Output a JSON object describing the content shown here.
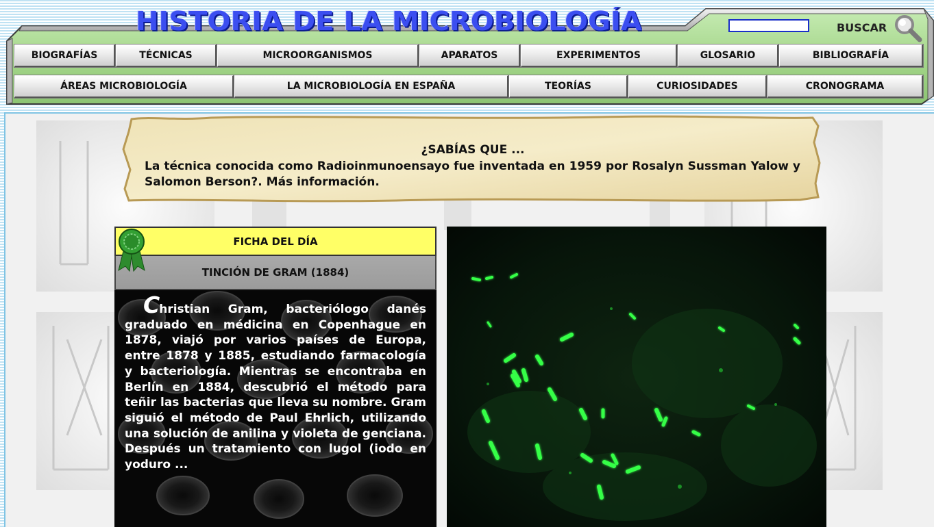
{
  "header": {
    "site_title": "HISTORIA DE LA MICROBIOLOGÍA",
    "search": {
      "value": "",
      "button_label": "BUSCAR"
    }
  },
  "nav": {
    "row1": [
      {
        "label": "BIOGRAFÍAS"
      },
      {
        "label": "TÉCNICAS"
      },
      {
        "label": "MICROORGANISMOS"
      },
      {
        "label": "APARATOS"
      },
      {
        "label": "EXPERIMENTOS"
      },
      {
        "label": "GLOSARIO"
      },
      {
        "label": "BIBLIOGRAFÍA"
      }
    ],
    "row2": [
      {
        "label": "ÁREAS MICROBIOLOGÍA"
      },
      {
        "label": "LA MICROBIOLOGÍA EN ESPAÑA"
      },
      {
        "label": "TEORÍAS"
      },
      {
        "label": "CURIOSIDADES"
      },
      {
        "label": "CRONOGRAMA"
      }
    ]
  },
  "fact": {
    "heading": "¿SABÍAS QUE ...",
    "text": "La técnica conocida como Radioinmunoensayo fue inventada en 1959 por Rosalyn Sussman Yalow y Salomon Berson?.",
    "link_text": "Más información."
  },
  "card": {
    "header": "FICHA DEL DÍA",
    "title": "TINCIÓN DE GRAM (1884)",
    "drop_cap": "C",
    "body": "hristian Gram, bacteriólogo danés graduado en médicina en Copenhague en 1878, viajó por varios países de Europa, entre 1878 y 1885, estudiando farmacología y bacteriología. Mientras se encontraba en Berlín en 1884, descubrió el método para teñir las bacterias que lleva su nombre. Gram siguió el método de Paul Ehrlich, utilizando una solución de anilina y violeta de genciana. Después un tratamiento con lugol (iodo en yoduro ..."
  },
  "colors": {
    "header_green": "#a6d78c",
    "header_stripe_blue": "#bfe2f3",
    "title_blue": "#3b4ef0",
    "card_header_yellow": "#ffff66",
    "fluorescence_green": "#33ff44"
  }
}
